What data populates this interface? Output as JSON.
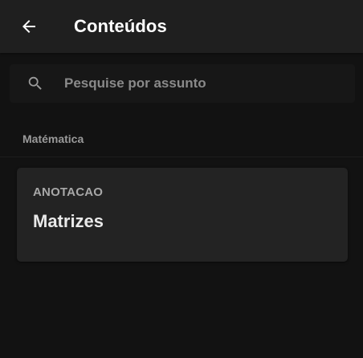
{
  "appbar": {
    "title": "Conteúdos",
    "back_icon": "arrow-left-icon"
  },
  "search": {
    "placeholder": "Pesquise por assunto",
    "value": "",
    "icon": "search-icon"
  },
  "section": {
    "label": "Matématica"
  },
  "cards": [
    {
      "type_label": "ANOTACAO",
      "title": "Matrizes"
    }
  ],
  "colors": {
    "background": "#121212",
    "appbar": "#1f1f1f",
    "card": "#232323",
    "title_text": "#ffffff",
    "muted_text": "#9a9a9a"
  }
}
